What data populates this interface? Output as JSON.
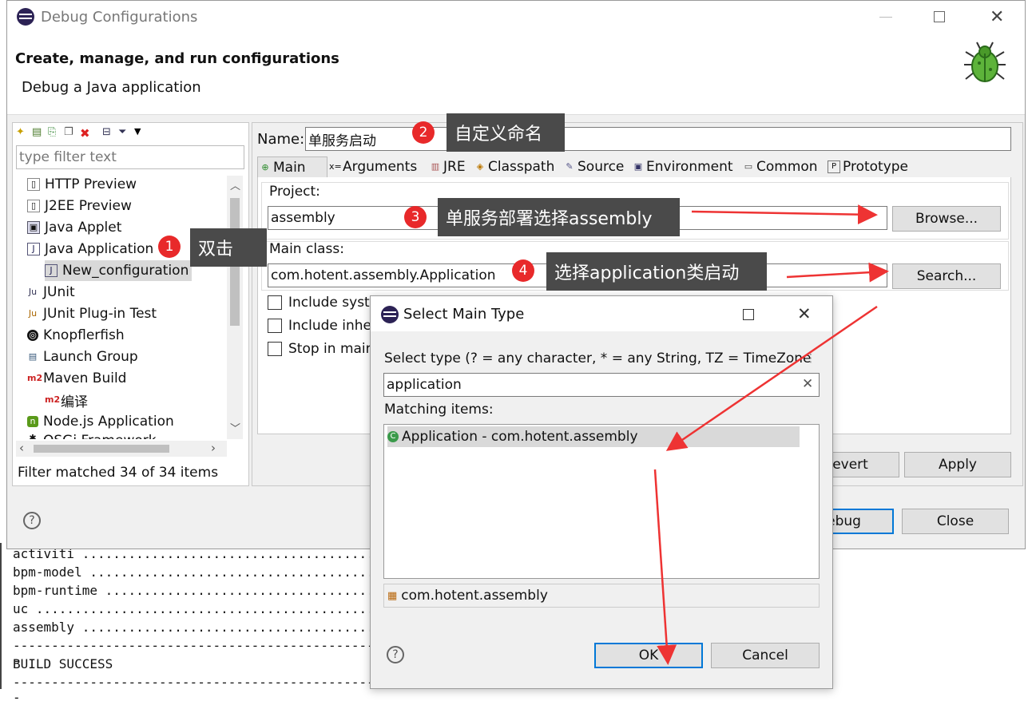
{
  "console": {
    "lines": [
      "activiti ......................................",
      "bpm-model .....................................",
      "bpm-runtime ...................................",
      "uc ............................................",
      "assembly ......................................",
      "------------------------------------------------",
      "BUILD SUCCESS",
      "------------------------------------------------"
    ]
  },
  "window": {
    "title": "Debug Configurations",
    "heading": "Create, manage, and run configurations",
    "subheading": "Debug a Java application"
  },
  "left": {
    "filter_placeholder": "type filter text",
    "tree": [
      "HTTP Preview",
      "J2EE Preview",
      "Java Applet",
      "Java Application",
      "New_configuration",
      "JUnit",
      "JUnit Plug-in Test",
      "Knopflerfish",
      "Launch Group",
      "Maven Build",
      "编译",
      "Node.js Application",
      "OSGi Framework"
    ],
    "status": "Filter matched 34 of 34 items"
  },
  "config": {
    "name_label": "Name:",
    "name_value": "单服务启动",
    "tabs": [
      "Main",
      "Arguments",
      "JRE",
      "Classpath",
      "Source",
      "Environment",
      "Common",
      "Prototype"
    ],
    "project_label": "Project:",
    "project_value": "assembly",
    "browse": "Browse...",
    "main_class_label": "Main class:",
    "main_class_value": "com.hotent.assembly.Application",
    "search": "Search...",
    "check1": "Include syste",
    "check2": "Include inhe",
    "check3": "Stop in main",
    "revert": "Revert",
    "apply": "Apply",
    "debug": "Debug",
    "close": "Close"
  },
  "dialog": {
    "title": "Select Main Type",
    "prompt": "Select type (? = any character, * = any String, TZ = TimeZone)",
    "filter_value": "application",
    "matching_label": "Matching items:",
    "match_item": "Application - com.hotent.assembly",
    "package": "com.hotent.assembly",
    "ok": "OK",
    "cancel": "Cancel"
  },
  "callouts": {
    "n1": "1",
    "c1": "双击",
    "n2": "2",
    "c2": "自定义命名",
    "n3": "3",
    "c3": "单服务部署选择assembly",
    "n4": "4",
    "c4": "选择application类启动"
  },
  "colors": {
    "callout_bg": "#4a4a4a",
    "badge": "#e8292a",
    "arrow": "#ee3333",
    "selection": "#cce8ff"
  }
}
